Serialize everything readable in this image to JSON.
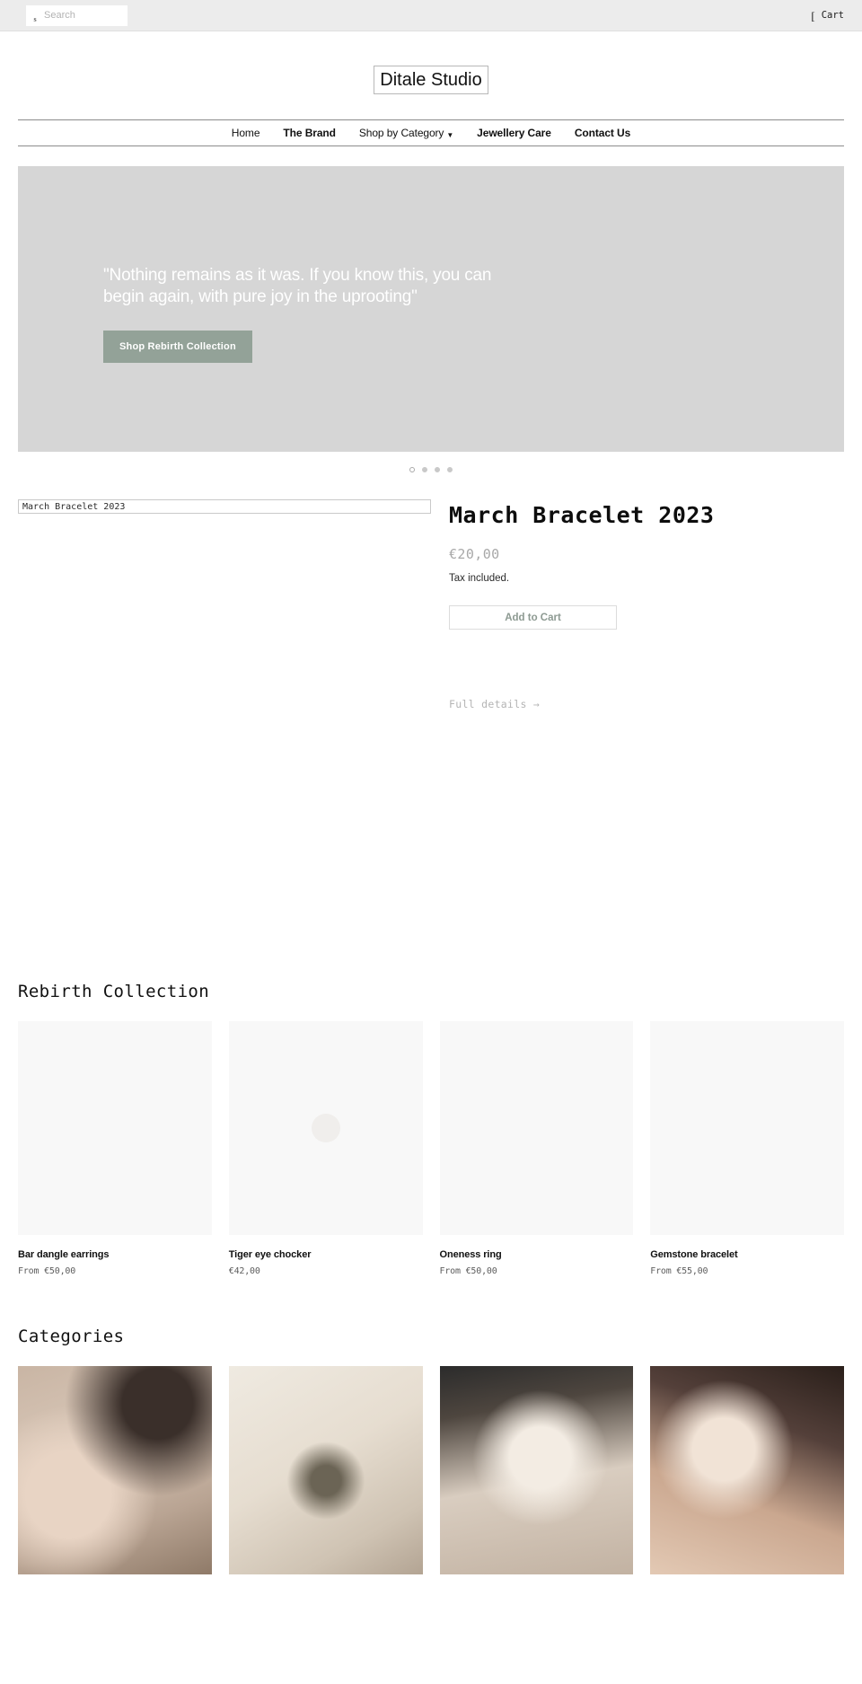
{
  "utility_bar": {
    "search": {
      "placeholder": "Search",
      "value": "",
      "icon": "search-icon",
      "icon_glyph": "s"
    },
    "cart": {
      "label": "Cart",
      "icon": "cart-icon",
      "icon_glyph": "["
    }
  },
  "header": {
    "logo_alt": "Ditale Studio"
  },
  "nav": {
    "items": [
      {
        "label": "Home",
        "bold": false,
        "caret": ""
      },
      {
        "label": "The Brand",
        "bold": true,
        "caret": ""
      },
      {
        "label": "Shop by Category",
        "bold": false,
        "caret": "▼"
      },
      {
        "label": "Jewellery Care",
        "bold": true,
        "caret": ""
      },
      {
        "label": "Contact Us",
        "bold": true,
        "caret": ""
      }
    ]
  },
  "hero": {
    "quote": "\"Nothing remains as it was. If you know this, you can begin again, with pure joy in the uprooting\"",
    "cta_label": "Shop Rebirth Collection",
    "cta_color": "#93a298",
    "background_color": "#d6d6d6",
    "dots": [
      {
        "active": false
      },
      {
        "active": true
      },
      {
        "active": true
      },
      {
        "active": true
      }
    ]
  },
  "featured_product": {
    "image_alt": "March Bracelet 2023",
    "title": "March Bracelet 2023",
    "price": "€20,00",
    "tax_note": "Tax included.",
    "add_to_cart_label": "Add to Cart",
    "full_details_label": "Full details →"
  },
  "rebirth_collection": {
    "heading": "Rebirth Collection",
    "products": [
      {
        "name": "Bar dangle earrings",
        "price": "From €50,00"
      },
      {
        "name": "Tiger eye chocker",
        "price": "€42,00"
      },
      {
        "name": "Oneness ring",
        "price": "From €50,00"
      },
      {
        "name": "Gemstone bracelet",
        "price": "From €55,00"
      }
    ]
  },
  "categories": {
    "heading": "Categories",
    "tiles": [
      {
        "name": "category-necklaces"
      },
      {
        "name": "category-bracelets"
      },
      {
        "name": "category-rings"
      },
      {
        "name": "category-earrings"
      }
    ]
  }
}
